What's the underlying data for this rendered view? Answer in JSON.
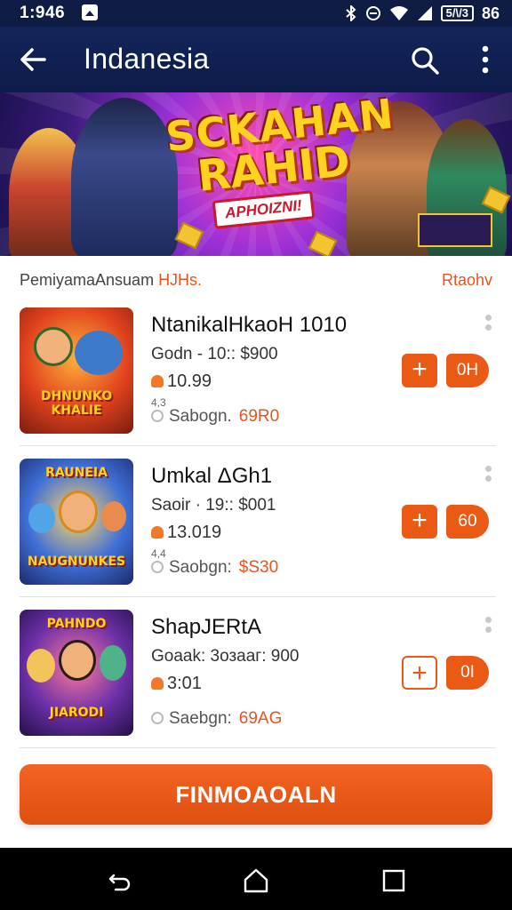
{
  "status_bar": {
    "time": "1:946",
    "battery": "5/\\/3",
    "percent": "86"
  },
  "app_bar": {
    "title": "Indanesia"
  },
  "banner": {
    "line1": "SCKAHAN",
    "line2": "RAHID",
    "ribbon": "APHOIZNI!"
  },
  "section": {
    "left_prefix": "PemiyamaAnsuam ",
    "left_highlight": "HJHs.",
    "right_link": "Rtaohv"
  },
  "items": [
    {
      "name": "NtanikalHkaoH 1010",
      "sub": "Godn - 10:: $900",
      "price": "10.99",
      "mini": "4,3",
      "seller": "Sabogn.",
      "code": "69R0",
      "qty": "0H",
      "thumb_top": "",
      "thumb_tag": "DHNUNKO KHALIE"
    },
    {
      "name": "Umkal ΔGh1",
      "sub": "Saoir · 19:: $001",
      "price": "13.019",
      "mini": "4,4",
      "seller": "Saobgn:",
      "code": "$S30",
      "qty": "60",
      "thumb_top": "RAUNEIA",
      "thumb_tag": "NAUGNUNKES"
    },
    {
      "name": "ShарJERtA",
      "sub": "Goaak: 3озааг: 900",
      "price": "3:01",
      "mini": "",
      "seller": "Saebgn:",
      "code": "69AG",
      "qty": "0I",
      "thumb_top": "PAHNDO",
      "thumb_tag": "JIARODI"
    }
  ],
  "cta": {
    "label": "FINMOAOALN"
  },
  "colors": {
    "accent": "#ea5a14",
    "header": "#0f1d45"
  }
}
